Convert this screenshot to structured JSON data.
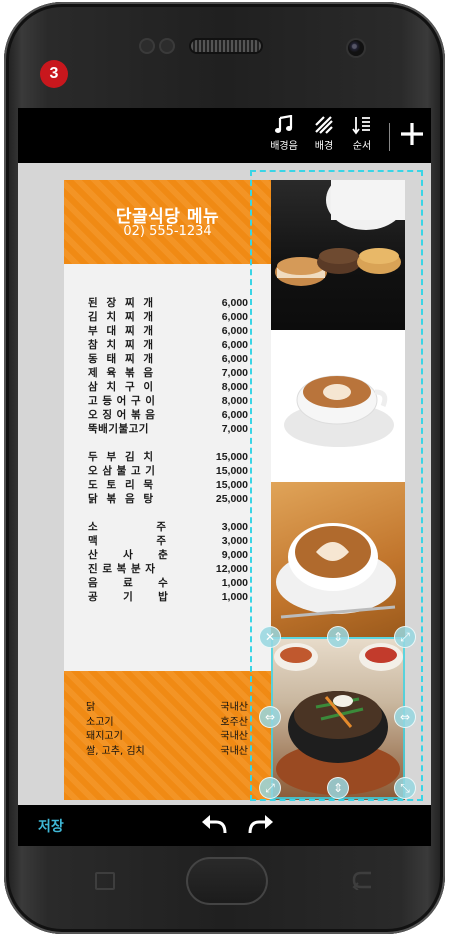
{
  "step_badge": "3",
  "toolbar": {
    "bgm_label": "배경음",
    "bg_label": "배경",
    "order_label": "순서",
    "add_icon": "plus-icon"
  },
  "menu": {
    "title": "단골식당 메뉴",
    "phone": "02) 555-1234",
    "group1": [
      {
        "name": "된  장  찌  개",
        "price": "6,000"
      },
      {
        "name": "김  치  찌  개",
        "price": "6,000"
      },
      {
        "name": "부  대  찌  개",
        "price": "6,000"
      },
      {
        "name": "참  치  찌  개",
        "price": "6,000"
      },
      {
        "name": "동  태  찌  개",
        "price": "6,000"
      },
      {
        "name": "제  육  볶  음",
        "price": "7,000"
      },
      {
        "name": "삼  치  구  이",
        "price": "8,000"
      },
      {
        "name": "고 등 어 구 이",
        "price": "8,000"
      },
      {
        "name": "오 징 어 볶 음",
        "price": "6,000"
      },
      {
        "name": "뚝배기불고기",
        "price": "7,000"
      }
    ],
    "group2": [
      {
        "name": "두  부  김  치",
        "price": "15,000"
      },
      {
        "name": "오 삼 불 고 기",
        "price": "15,000"
      },
      {
        "name": "도  토  리  묵",
        "price": "15,000"
      },
      {
        "name": "닭  볶  음  탕",
        "price": "25,000"
      }
    ],
    "group3": [
      {
        "name": "소              주",
        "price": "3,000"
      },
      {
        "name": "맥              주",
        "price": "3,000"
      },
      {
        "name": "산      사      춘",
        "price": "9,000"
      },
      {
        "name": "진 로 복 분 자",
        "price": "12,000"
      },
      {
        "name": "음      료      수",
        "price": "1,000"
      },
      {
        "name": "공      기      밥",
        "price": "1,000"
      }
    ],
    "origins": [
      {
        "item": "닭",
        "origin": "국내산"
      },
      {
        "item": "소고기",
        "origin": "호주산"
      },
      {
        "item": "돼지고기",
        "origin": "국내산"
      },
      {
        "item": "쌀, 고추, 김치",
        "origin": "국내산"
      }
    ]
  },
  "bottom": {
    "save_label": "저장"
  },
  "colors": {
    "accent_orange": "#f08a14",
    "selection_cyan": "#39d5e6",
    "save_blue": "#3fb7d6",
    "badge_red": "#c8171d"
  }
}
